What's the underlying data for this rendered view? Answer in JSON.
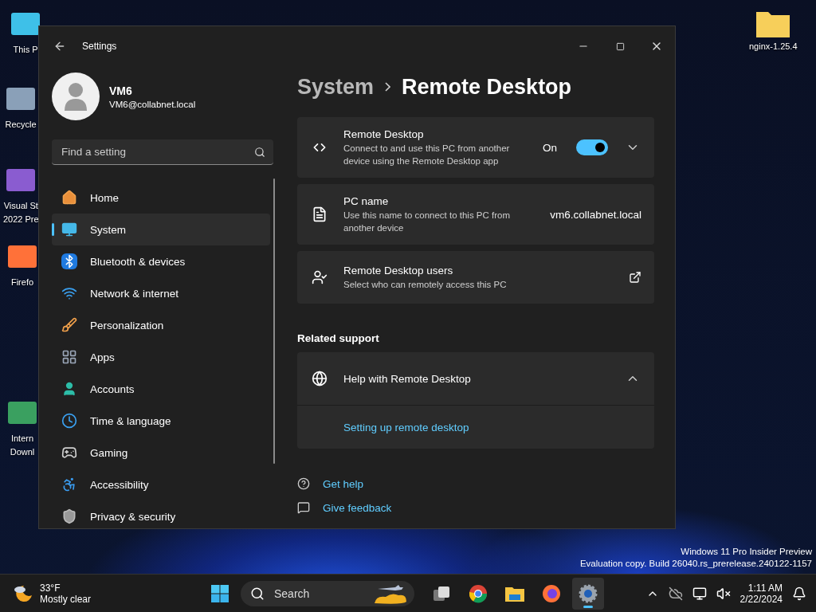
{
  "desktop_icons": [
    {
      "lines": [
        "This P"
      ]
    },
    {
      "lines": [
        "Recycle"
      ]
    },
    {
      "lines": [
        "Visual St",
        "2022 Pre"
      ]
    },
    {
      "lines": [
        "Firefo"
      ]
    },
    {
      "lines": [
        "Intern",
        "Downl"
      ]
    },
    {
      "lines": [
        "nginx-1.25.4"
      ]
    }
  ],
  "window": {
    "title": "Settings",
    "user": {
      "name": "VM6",
      "email": "VM6@collabnet.local"
    },
    "search": {
      "placeholder": "Find a setting"
    },
    "nav": [
      {
        "label": "Home",
        "selected": false
      },
      {
        "label": "System",
        "selected": true
      },
      {
        "label": "Bluetooth & devices",
        "selected": false
      },
      {
        "label": "Network & internet",
        "selected": false
      },
      {
        "label": "Personalization",
        "selected": false
      },
      {
        "label": "Apps",
        "selected": false
      },
      {
        "label": "Accounts",
        "selected": false
      },
      {
        "label": "Time & language",
        "selected": false
      },
      {
        "label": "Gaming",
        "selected": false
      },
      {
        "label": "Accessibility",
        "selected": false
      },
      {
        "label": "Privacy & security",
        "selected": false
      }
    ],
    "breadcrumb": {
      "parent": "System",
      "current": "Remote Desktop"
    },
    "cards": [
      {
        "kind": "toggle",
        "title": "Remote Desktop",
        "description": "Connect to and use this PC from another device using the Remote Desktop app",
        "state_label": "On",
        "on": true,
        "expanded": false
      },
      {
        "kind": "value",
        "title": "PC name",
        "description": "Use this name to connect to this PC from another device",
        "value": "vm6.collabnet.local"
      },
      {
        "kind": "link",
        "title": "Remote Desktop users",
        "description": "Select who can remotely access this PC"
      }
    ],
    "related_support": {
      "heading": "Related support",
      "title": "Help with Remote Desktop",
      "expanded": true,
      "links": [
        "Setting up remote desktop"
      ]
    },
    "footer_links": [
      "Get help",
      "Give feedback"
    ]
  },
  "edition_notice": [
    "Windows 11 Pro Insider Preview",
    "Evaluation copy. Build 26040.rs_prerelease.240122-1157"
  ],
  "taskbar": {
    "weather": {
      "temperature": "33°F",
      "condition": "Mostly clear"
    },
    "search": {
      "placeholder": "Search"
    },
    "apps": [
      {
        "kind": "taskview",
        "selected": false
      },
      {
        "kind": "browser",
        "selected": false
      },
      {
        "kind": "files",
        "selected": false
      },
      {
        "kind": "firefox",
        "selected": false
      },
      {
        "kind": "settings",
        "selected": true
      }
    ],
    "clock": {
      "time": "1:11 AM",
      "date": "2/22/2024"
    }
  }
}
